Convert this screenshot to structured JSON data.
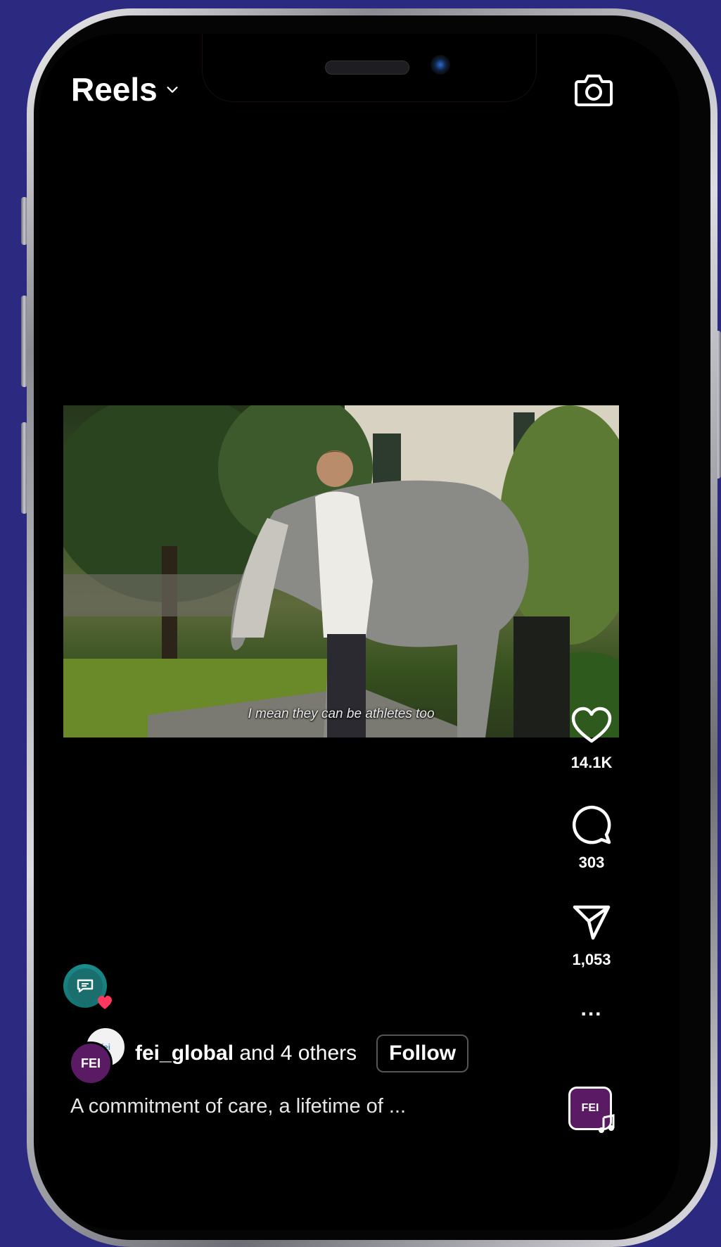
{
  "header": {
    "title": "Reels"
  },
  "video": {
    "subtitle": "I mean they can be athletes too"
  },
  "actions": {
    "likes": "14.1K",
    "comments": "303",
    "shares": "1,053",
    "more": "..."
  },
  "author": {
    "username": "fei_global",
    "others": " and 4 others",
    "follow_label": "Follow",
    "avatar_primary_text": "FEI",
    "avatar_secondary_text": "fei"
  },
  "caption": "A commitment of care, a lifetime of ...",
  "audio": {
    "thumb_text": "FEI"
  },
  "colors": {
    "background": "#2b2a80",
    "like_badge": "#ff3860",
    "fei_purple": "#5a1a64"
  }
}
